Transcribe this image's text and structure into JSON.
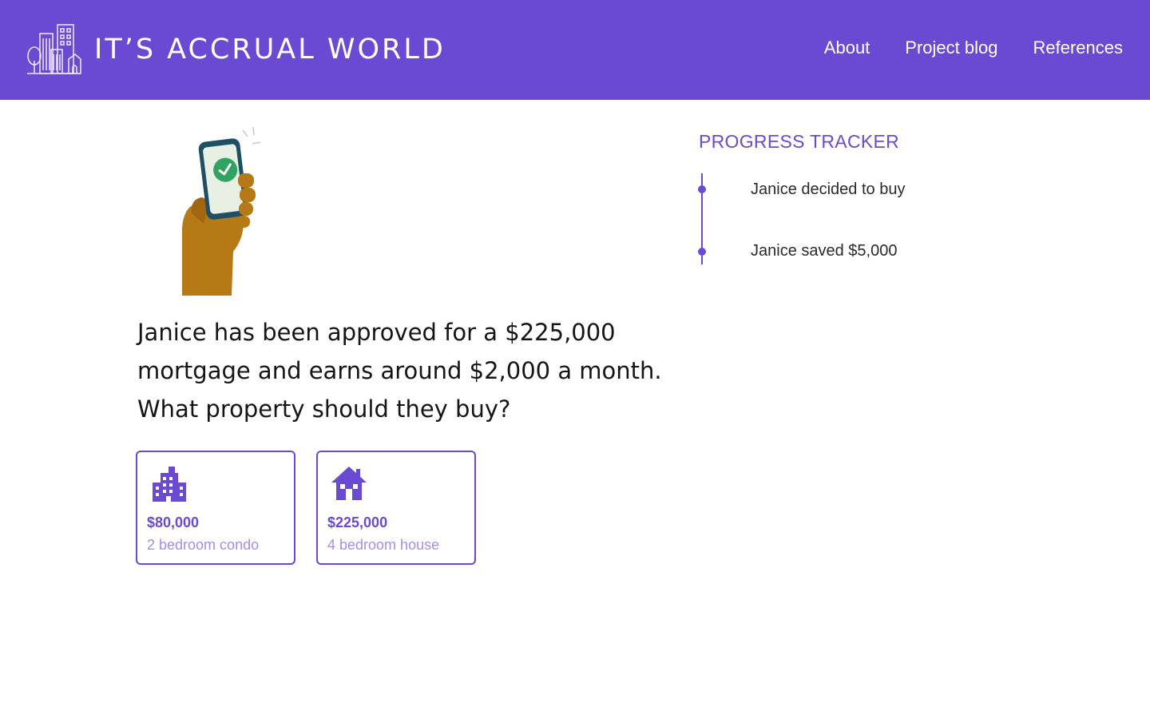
{
  "header": {
    "title": "IT’S ACCRUAL WORLD",
    "brand_color": "#6b4ad3",
    "logo_icon": "city-buildings-icon"
  },
  "nav": {
    "items": [
      {
        "label": "About"
      },
      {
        "label": "Project blog"
      },
      {
        "label": "References"
      }
    ]
  },
  "illustration": {
    "icon": "hand-holding-phone-checkmark-icon"
  },
  "main": {
    "question": "Janice has been approved for a $225,000 mortgage and earns around $2,000 a month. What property should they buy?"
  },
  "options": [
    {
      "icon": "apartment-building-icon",
      "price": "$80,000",
      "description": "2 bedroom condo"
    },
    {
      "icon": "house-icon",
      "price": "$225,000",
      "description": "4 bedroom house"
    }
  ],
  "tracker": {
    "title": "PROGRESS TRACKER",
    "steps": [
      {
        "label": "Janice decided to buy"
      },
      {
        "label": "Janice saved $5,000"
      }
    ]
  }
}
